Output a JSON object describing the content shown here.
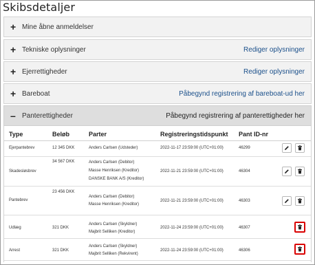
{
  "page": {
    "title": "Skibsdetaljer"
  },
  "panels": [
    {
      "label": "Mine åbne anmeldelser",
      "link": ""
    },
    {
      "label": "Tekniske oplysninger",
      "link": "Rediger oplysninger"
    },
    {
      "label": "Ejerrettigheder",
      "link": "Rediger oplysninger"
    },
    {
      "label": "Bareboat",
      "link": "Påbegynd registrering af bareboat-ud her"
    }
  ],
  "panterettigheder": {
    "label": "Panterettigheder",
    "link": "Påbegynd registrering af panterettigheder her",
    "columns": [
      "Type",
      "Beløb",
      "Parter",
      "Registreringstidspunkt",
      "Pant ID-nr"
    ],
    "rows": [
      {
        "type": "Ejerpantebrev",
        "amount": "12 345 DKK",
        "parties": [
          "Anders Carlsen (Udsteder)"
        ],
        "time": "2022-11-17 23:59:00 (UTC+01:00)",
        "id": "46299"
      },
      {
        "type": "Skadesløsbrev",
        "amount": "34 567 DKK",
        "parties": [
          "Anders Carlsen (Debitor)",
          "Masse Henriksen (Kreditor)",
          "DANSKE BANK A/S (Kreditor)"
        ],
        "time": "2022-11-21 23:59:00 (UTC+01:00)",
        "id": "46304"
      },
      {
        "type": "Pantebrev",
        "amount": "23 456 DKK",
        "parties": [
          "Anders Carlsen (Debitor)",
          "Masse Henriksen (Kreditor)"
        ],
        "time": "2022-11-21 23:59:00 (UTC+01:00)",
        "id": "46303"
      },
      {
        "type": "Udlæg",
        "amount": "321 DKK",
        "parties": [
          "Anders Carlsen (Skyldner)",
          "Majbrit Selliken (Kreditor)"
        ],
        "time": "2022-11-24 23:59:00 (UTC+01:00)",
        "id": "46307"
      },
      {
        "type": "Arrest",
        "amount": "321 DKK",
        "parties": [
          "Anders Carlsen (Skyldner)",
          "Majbrit Selliken (Rekvirent)"
        ],
        "time": "2022-11-24 23:59:00 (UTC+01:00)",
        "id": "46306"
      }
    ]
  }
}
